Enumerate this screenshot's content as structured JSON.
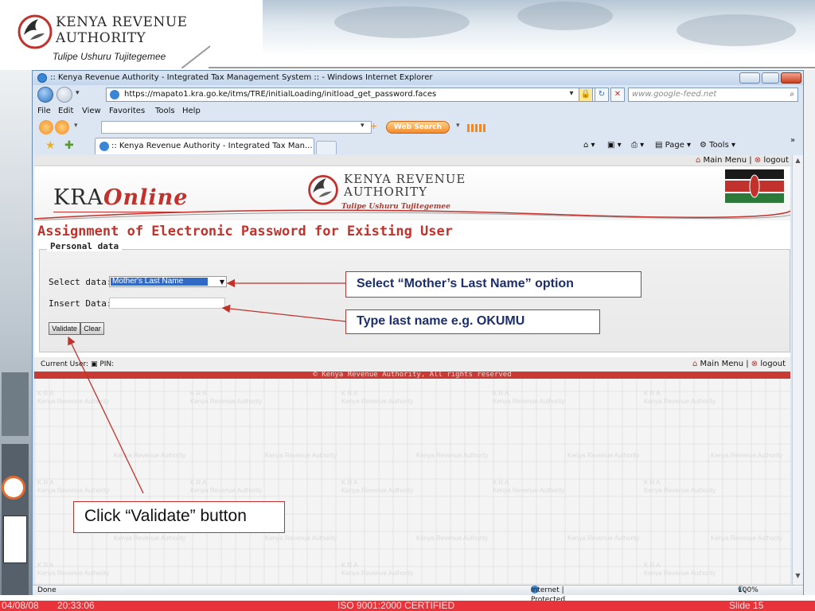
{
  "slide": {
    "org_name_line1": "KENYA REVENUE",
    "org_name_line2": "AUTHORITY",
    "slogan": "Tulipe Ushuru Tujitegemee",
    "footer_date": "04/08/08",
    "footer_time": "20:33:06",
    "footer_center": "ISO 9001:2000 CERTIFIED",
    "footer_slide": "Slide 15",
    "accent_color": "#e8333a"
  },
  "browser": {
    "title": ":: Kenya Revenue Authority - Integrated Tax Management System :: - Windows Internet Explorer",
    "address": "https://mapato1.kra.go.ke/itms/TRE/initialLoading/initload_get_password.faces",
    "search_placeholder": "www.google-feed.net",
    "menu": [
      "File",
      "Edit",
      "View",
      "Favorites",
      "Tools",
      "Help"
    ],
    "web_search_label": "Web Search",
    "tab_title": ":: Kenya Revenue Authority - Integrated Tax Man...",
    "cmd_page": "Page",
    "cmd_tools": "Tools",
    "status_left": "Done",
    "status_zone": "Internet | Protected Mode: Off",
    "zoom": "100%"
  },
  "page": {
    "nav_main_menu": "Main Menu",
    "nav_logout": "logout",
    "kra_online_prefix": "KRA",
    "kra_online_suffix": "Online",
    "header_name_line1": "KENYA REVENUE",
    "header_name_line2": "AUTHORITY",
    "header_slogan": "Tulipe Ushuru Tujitegemee",
    "title": "Assignment of Electronic Password for Existing User",
    "section_legend": "Personal data",
    "select_label": "Select data:",
    "select_value": "Mother's Last Name",
    "insert_label": "Insert Data:",
    "insert_value": "",
    "validate_label": "Validate",
    "clear_label": "Clear",
    "current_user_label": "Current User:",
    "pin_label": "PIN:",
    "copyright": "© Kenya Revenue Authority, All rights reserved",
    "watermark_text": "Kenya Revenue Authority",
    "watermark_short": "K R A"
  },
  "annotations": {
    "select_hint": "Select “Mother’s Last Name” option",
    "type_hint": "Type last name e.g. OKUMU",
    "click_hint": "Click “Validate” button"
  }
}
